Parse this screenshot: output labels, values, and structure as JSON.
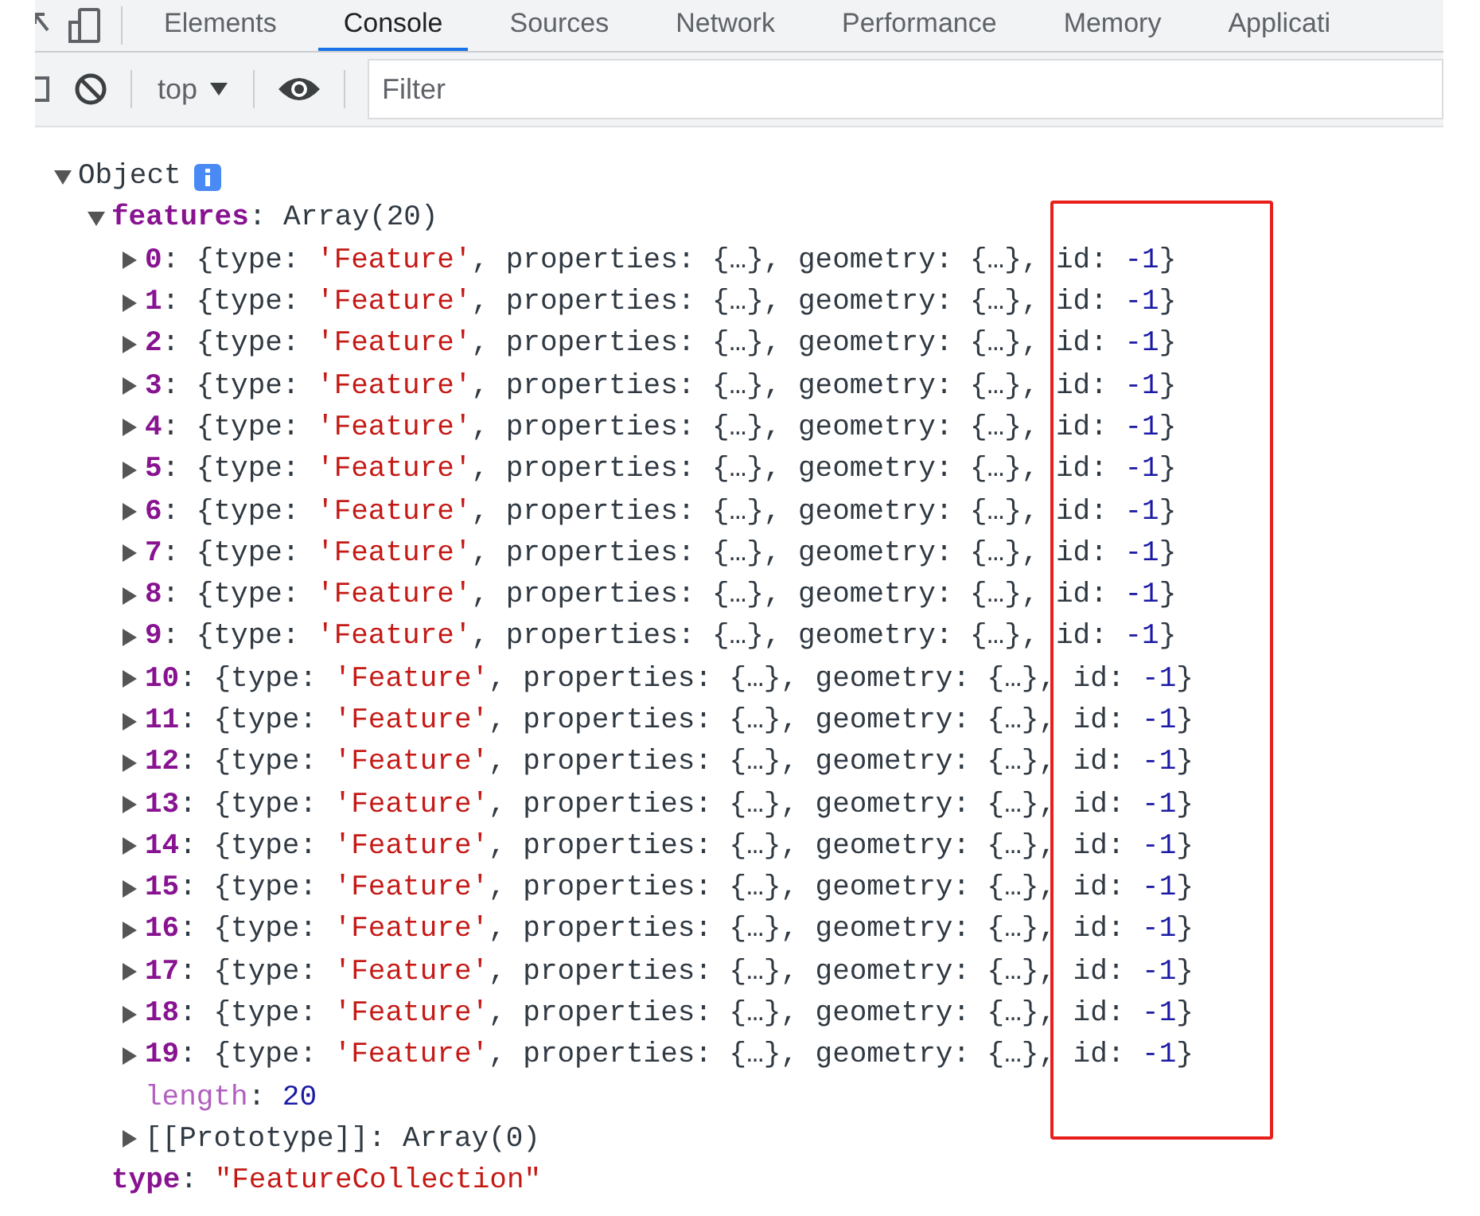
{
  "tabs": [
    {
      "label": "Elements",
      "selected": false
    },
    {
      "label": "Console",
      "selected": true
    },
    {
      "label": "Sources",
      "selected": false
    },
    {
      "label": "Network",
      "selected": false
    },
    {
      "label": "Performance",
      "selected": false
    },
    {
      "label": "Memory",
      "selected": false
    },
    {
      "label": "Applicati",
      "selected": false
    }
  ],
  "console_toolbar": {
    "context": "top",
    "filter": {
      "placeholder": "Filter"
    }
  },
  "tree": {
    "label": "Object",
    "info": true,
    "expanded": true,
    "children": [
      {
        "key": "features",
        "kind": "own",
        "value": [
          {
            "kind": "punct",
            "text": ": Array(20)"
          }
        ],
        "expanded": true,
        "children": [
          {
            "key": "0",
            "kind": "own",
            "expanded": false,
            "value": [
              {
                "kind": "punct",
                "text": ": {type: "
              },
              {
                "kind": "string",
                "text": "'Feature'"
              },
              {
                "kind": "punct",
                "text": ", properties: {…}, geometry: {…}, id: "
              },
              {
                "kind": "number",
                "text": "-1"
              },
              {
                "kind": "punct",
                "text": "}"
              }
            ]
          },
          {
            "key": "1",
            "kind": "own",
            "expanded": false,
            "value": [
              {
                "kind": "punct",
                "text": ": {type: "
              },
              {
                "kind": "string",
                "text": "'Feature'"
              },
              {
                "kind": "punct",
                "text": ", properties: {…}, geometry: {…}, id: "
              },
              {
                "kind": "number",
                "text": "-1"
              },
              {
                "kind": "punct",
                "text": "}"
              }
            ]
          },
          {
            "key": "2",
            "kind": "own",
            "expanded": false,
            "value": [
              {
                "kind": "punct",
                "text": ": {type: "
              },
              {
                "kind": "string",
                "text": "'Feature'"
              },
              {
                "kind": "punct",
                "text": ", properties: {…}, geometry: {…}, id: "
              },
              {
                "kind": "number",
                "text": "-1"
              },
              {
                "kind": "punct",
                "text": "}"
              }
            ]
          },
          {
            "key": "3",
            "kind": "own",
            "expanded": false,
            "value": [
              {
                "kind": "punct",
                "text": ": {type: "
              },
              {
                "kind": "string",
                "text": "'Feature'"
              },
              {
                "kind": "punct",
                "text": ", properties: {…}, geometry: {…}, id: "
              },
              {
                "kind": "number",
                "text": "-1"
              },
              {
                "kind": "punct",
                "text": "}"
              }
            ]
          },
          {
            "key": "4",
            "kind": "own",
            "expanded": false,
            "value": [
              {
                "kind": "punct",
                "text": ": {type: "
              },
              {
                "kind": "string",
                "text": "'Feature'"
              },
              {
                "kind": "punct",
                "text": ", properties: {…}, geometry: {…}, id: "
              },
              {
                "kind": "number",
                "text": "-1"
              },
              {
                "kind": "punct",
                "text": "}"
              }
            ]
          },
          {
            "key": "5",
            "kind": "own",
            "expanded": false,
            "value": [
              {
                "kind": "punct",
                "text": ": {type: "
              },
              {
                "kind": "string",
                "text": "'Feature'"
              },
              {
                "kind": "punct",
                "text": ", properties: {…}, geometry: {…}, id: "
              },
              {
                "kind": "number",
                "text": "-1"
              },
              {
                "kind": "punct",
                "text": "}"
              }
            ]
          },
          {
            "key": "6",
            "kind": "own",
            "expanded": false,
            "value": [
              {
                "kind": "punct",
                "text": ": {type: "
              },
              {
                "kind": "string",
                "text": "'Feature'"
              },
              {
                "kind": "punct",
                "text": ", properties: {…}, geometry: {…}, id: "
              },
              {
                "kind": "number",
                "text": "-1"
              },
              {
                "kind": "punct",
                "text": "}"
              }
            ]
          },
          {
            "key": "7",
            "kind": "own",
            "expanded": false,
            "value": [
              {
                "kind": "punct",
                "text": ": {type: "
              },
              {
                "kind": "string",
                "text": "'Feature'"
              },
              {
                "kind": "punct",
                "text": ", properties: {…}, geometry: {…}, id: "
              },
              {
                "kind": "number",
                "text": "-1"
              },
              {
                "kind": "punct",
                "text": "}"
              }
            ]
          },
          {
            "key": "8",
            "kind": "own",
            "expanded": false,
            "value": [
              {
                "kind": "punct",
                "text": ": {type: "
              },
              {
                "kind": "string",
                "text": "'Feature'"
              },
              {
                "kind": "punct",
                "text": ", properties: {…}, geometry: {…}, id: "
              },
              {
                "kind": "number",
                "text": "-1"
              },
              {
                "kind": "punct",
                "text": "}"
              }
            ]
          },
          {
            "key": "9",
            "kind": "own",
            "expanded": false,
            "value": [
              {
                "kind": "punct",
                "text": ": {type: "
              },
              {
                "kind": "string",
                "text": "'Feature'"
              },
              {
                "kind": "punct",
                "text": ", properties: {…}, geometry: {…}, id: "
              },
              {
                "kind": "number",
                "text": "-1"
              },
              {
                "kind": "punct",
                "text": "}"
              }
            ]
          },
          {
            "key": "10",
            "kind": "own",
            "expanded": false,
            "value": [
              {
                "kind": "punct",
                "text": ": {type: "
              },
              {
                "kind": "string",
                "text": "'Feature'"
              },
              {
                "kind": "punct",
                "text": ", properties: {…}, geometry: {…}, id: "
              },
              {
                "kind": "number",
                "text": "-1"
              },
              {
                "kind": "punct",
                "text": "}"
              }
            ]
          },
          {
            "key": "11",
            "kind": "own",
            "expanded": false,
            "value": [
              {
                "kind": "punct",
                "text": ": {type: "
              },
              {
                "kind": "string",
                "text": "'Feature'"
              },
              {
                "kind": "punct",
                "text": ", properties: {…}, geometry: {…}, id: "
              },
              {
                "kind": "number",
                "text": "-1"
              },
              {
                "kind": "punct",
                "text": "}"
              }
            ]
          },
          {
            "key": "12",
            "kind": "own",
            "expanded": false,
            "value": [
              {
                "kind": "punct",
                "text": ": {type: "
              },
              {
                "kind": "string",
                "text": "'Feature'"
              },
              {
                "kind": "punct",
                "text": ", properties: {…}, geometry: {…}, id: "
              },
              {
                "kind": "number",
                "text": "-1"
              },
              {
                "kind": "punct",
                "text": "}"
              }
            ]
          },
          {
            "key": "13",
            "kind": "own",
            "expanded": false,
            "value": [
              {
                "kind": "punct",
                "text": ": {type: "
              },
              {
                "kind": "string",
                "text": "'Feature'"
              },
              {
                "kind": "punct",
                "text": ", properties: {…}, geometry: {…}, id: "
              },
              {
                "kind": "number",
                "text": "-1"
              },
              {
                "kind": "punct",
                "text": "}"
              }
            ]
          },
          {
            "key": "14",
            "kind": "own",
            "expanded": false,
            "value": [
              {
                "kind": "punct",
                "text": ": {type: "
              },
              {
                "kind": "string",
                "text": "'Feature'"
              },
              {
                "kind": "punct",
                "text": ", properties: {…}, geometry: {…}, id: "
              },
              {
                "kind": "number",
                "text": "-1"
              },
              {
                "kind": "punct",
                "text": "}"
              }
            ]
          },
          {
            "key": "15",
            "kind": "own",
            "expanded": false,
            "value": [
              {
                "kind": "punct",
                "text": ": {type: "
              },
              {
                "kind": "string",
                "text": "'Feature'"
              },
              {
                "kind": "punct",
                "text": ", properties: {…}, geometry: {…}, id: "
              },
              {
                "kind": "number",
                "text": "-1"
              },
              {
                "kind": "punct",
                "text": "}"
              }
            ]
          },
          {
            "key": "16",
            "kind": "own",
            "expanded": false,
            "value": [
              {
                "kind": "punct",
                "text": ": {type: "
              },
              {
                "kind": "string",
                "text": "'Feature'"
              },
              {
                "kind": "punct",
                "text": ", properties: {…}, geometry: {…}, id: "
              },
              {
                "kind": "number",
                "text": "-1"
              },
              {
                "kind": "punct",
                "text": "}"
              }
            ]
          },
          {
            "key": "17",
            "kind": "own",
            "expanded": false,
            "value": [
              {
                "kind": "punct",
                "text": ": {type: "
              },
              {
                "kind": "string",
                "text": "'Feature'"
              },
              {
                "kind": "punct",
                "text": ", properties: {…}, geometry: {…}, id: "
              },
              {
                "kind": "number",
                "text": "-1"
              },
              {
                "kind": "punct",
                "text": "}"
              }
            ]
          },
          {
            "key": "18",
            "kind": "own",
            "expanded": false,
            "value": [
              {
                "kind": "punct",
                "text": ": {type: "
              },
              {
                "kind": "string",
                "text": "'Feature'"
              },
              {
                "kind": "punct",
                "text": ", properties: {…}, geometry: {…}, id: "
              },
              {
                "kind": "number",
                "text": "-1"
              },
              {
                "kind": "punct",
                "text": "}"
              }
            ]
          },
          {
            "key": "19",
            "kind": "own",
            "expanded": false,
            "value": [
              {
                "kind": "punct",
                "text": ": {type: "
              },
              {
                "kind": "string",
                "text": "'Feature'"
              },
              {
                "kind": "punct",
                "text": ", properties: {…}, geometry: {…}, id: "
              },
              {
                "kind": "number",
                "text": "-1"
              },
              {
                "kind": "punct",
                "text": "}"
              }
            ]
          },
          {
            "key": "length",
            "kind": "hidden",
            "value": [
              {
                "kind": "punct",
                "text": ": "
              },
              {
                "kind": "number",
                "text": "20"
              }
            ]
          },
          {
            "key": "[[Prototype]]",
            "kind": "internal",
            "expanded": false,
            "value": [
              {
                "kind": "punct",
                "text": ": Array(0)"
              }
            ]
          }
        ]
      },
      {
        "key": "type",
        "kind": "own",
        "value": [
          {
            "kind": "punct",
            "text": ": "
          },
          {
            "kind": "string",
            "text": "\"FeatureCollection\""
          }
        ]
      }
    ]
  }
}
